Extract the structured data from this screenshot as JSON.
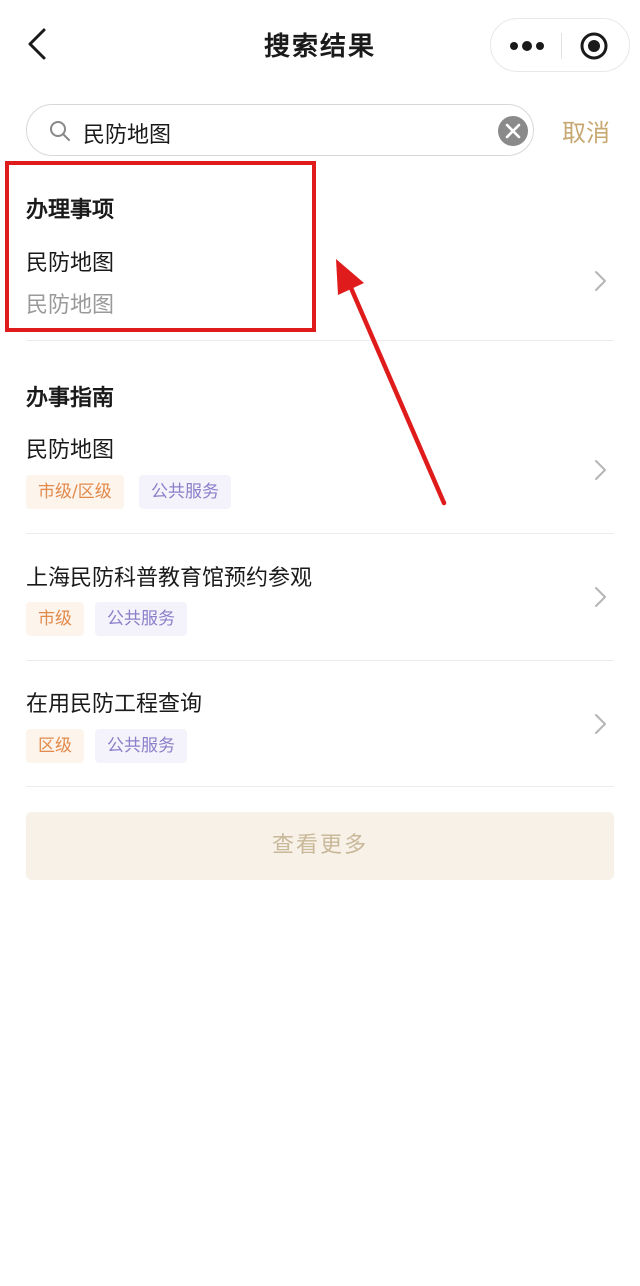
{
  "header": {
    "title": "搜索结果",
    "back_icon": "chevron-left-icon",
    "more_icon": "more-dots-icon",
    "capsule_icon": "target-icon"
  },
  "search": {
    "query": "民防地图",
    "cancel_label": "取消"
  },
  "sections": {
    "matters": {
      "title": "办理事项",
      "items": [
        {
          "title": "民防地图",
          "subtitle": "民防地图"
        }
      ]
    },
    "guides": {
      "title": "办事指南",
      "items": [
        {
          "title": "民防地图",
          "tags": [
            "市级/区级",
            "公共服务"
          ]
        },
        {
          "title": "上海民防科普教育馆预约参观",
          "tags": [
            "市级",
            "公共服务"
          ]
        },
        {
          "title": "在用民防工程查询",
          "tags": [
            "区级",
            "公共服务"
          ]
        }
      ]
    }
  },
  "more_button": {
    "label": "查看更多"
  },
  "colors": {
    "accent": "#c8a872",
    "tag_orange": "#e28a4b",
    "tag_purple": "#8a7fc9",
    "annotation_red": "#e01b1b"
  }
}
